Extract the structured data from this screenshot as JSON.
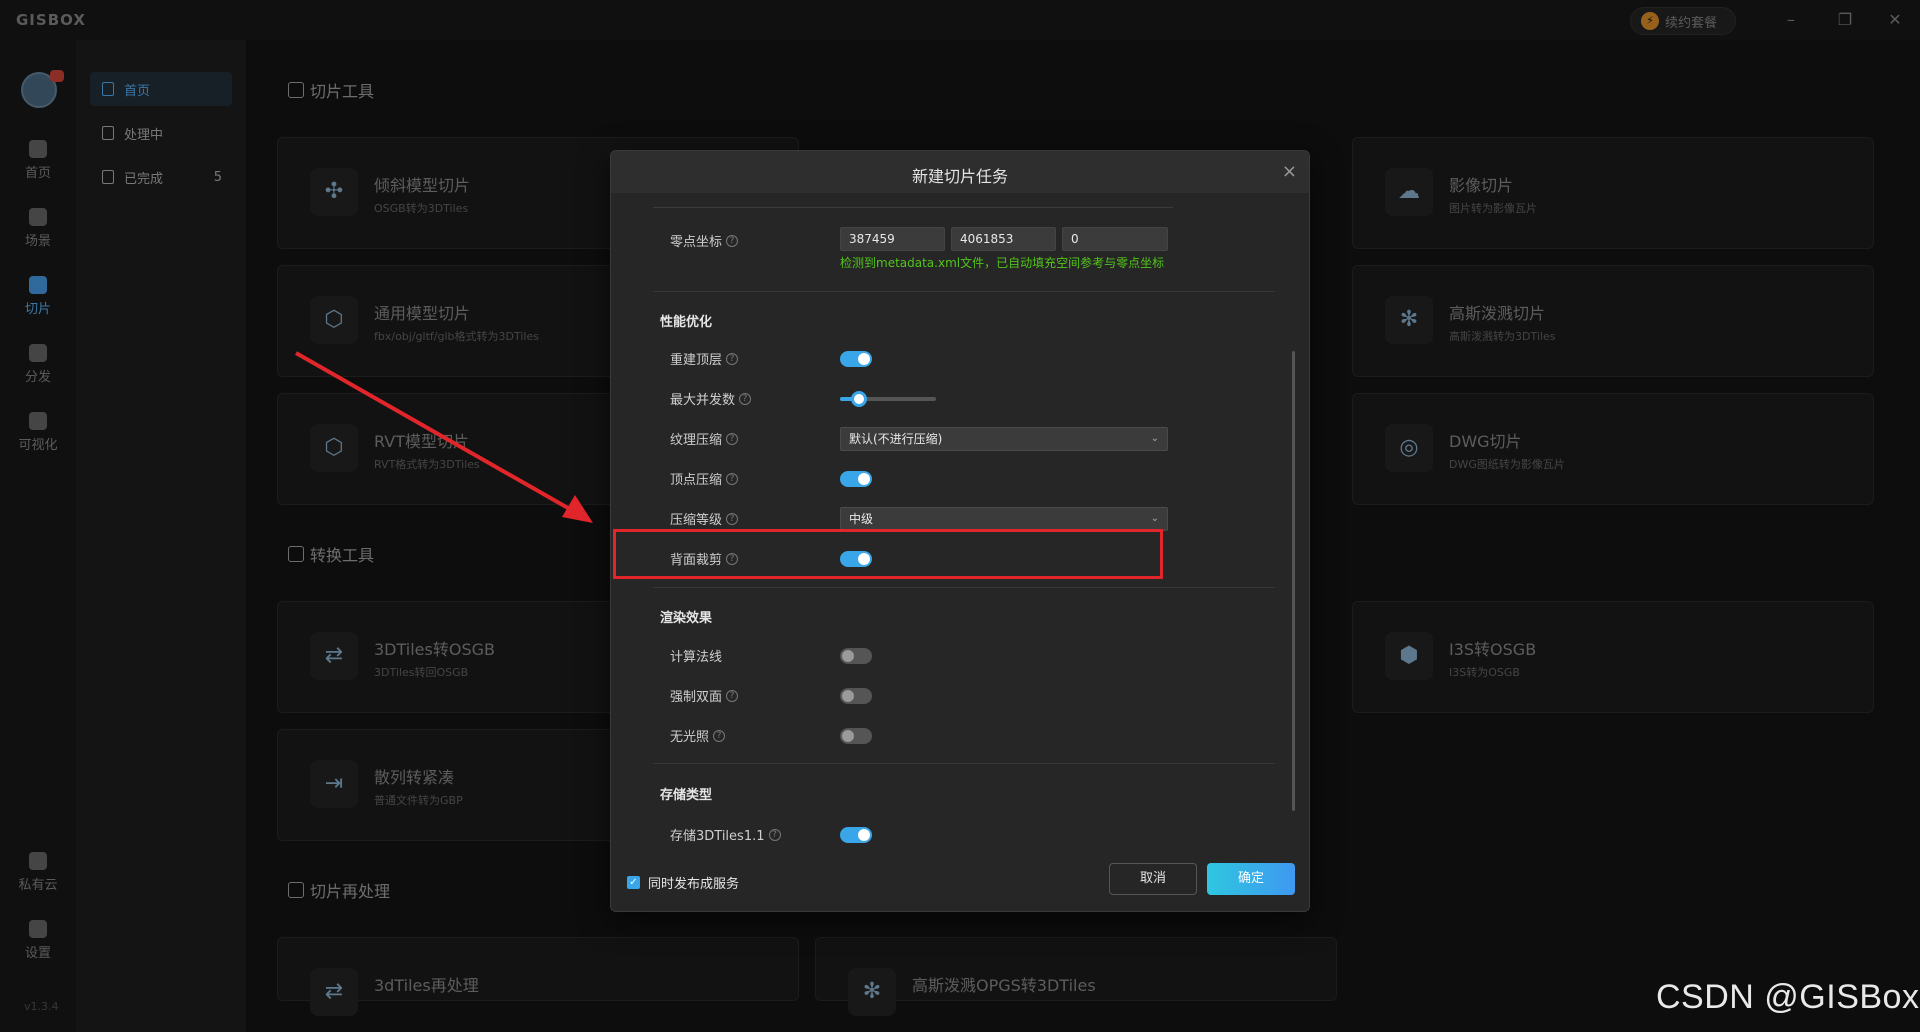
{
  "titlebar": {
    "brand": "GISBOX",
    "package_button": "续约套餐",
    "minimize": "–",
    "restore": "❐",
    "close": "✕"
  },
  "rail": {
    "items": [
      {
        "label": "首页"
      },
      {
        "label": "场景"
      },
      {
        "label": "切片"
      },
      {
        "label": "分发"
      },
      {
        "label": "可视化"
      },
      {
        "label": "私有云"
      },
      {
        "label": "设置"
      }
    ],
    "version": "v1.3.4"
  },
  "subnav": {
    "items": [
      {
        "label": "首页"
      },
      {
        "label": "处理中"
      },
      {
        "label": "已完成",
        "count": "5"
      }
    ]
  },
  "sections": {
    "slice_tools": "切片工具",
    "convert_tools": "转换工具",
    "reprocess": "切片再处理"
  },
  "cards": [
    {
      "title": "倾斜模型切片",
      "sub": "OSGB转为3DTiles"
    },
    {
      "title": "通用模型切片",
      "sub": "fbx/obj/gltf/glb格式转为3DTiles"
    },
    {
      "title": "RVT模型切片",
      "sub": "RVT格式转为3DTiles"
    },
    {
      "title": "影像切片",
      "sub": "图片转为影像瓦片"
    },
    {
      "title": "高斯泼溅切片",
      "sub": "高斯泼溅转为3DTiles"
    },
    {
      "title": "DWG切片",
      "sub": "DWG图纸转为影像瓦片"
    },
    {
      "title": "3DTiles转OSGB",
      "sub": "3DTiles转回OSGB"
    },
    {
      "title": "散列转紧凑",
      "sub": "普通文件转为GBP"
    },
    {
      "title": "I3S转OSGB",
      "sub": "I3S转为OSGB"
    },
    {
      "title": "3dTiles再处理",
      "sub": ""
    },
    {
      "title": "高斯泼溅OPGS转3DTiles",
      "sub": ""
    }
  ],
  "modal": {
    "title": "新建切片任务",
    "origin_label": "零点坐标",
    "origin": [
      "387459",
      "4061853",
      "0"
    ],
    "origin_hint": "检测到metadata.xml文件，已自动填充空间参考与零点坐标",
    "perf_group": "性能优化",
    "rebuild_top": {
      "label": "重建顶层",
      "on": true
    },
    "max_concurrency": {
      "label": "最大并发数",
      "value": 0.2
    },
    "texture_compress": {
      "label": "纹理压缩",
      "value": "默认(不进行压缩)"
    },
    "vertex_compress": {
      "label": "顶点压缩",
      "on": true
    },
    "compress_level": {
      "label": "压缩等级",
      "value": "中级"
    },
    "backface_cull": {
      "label": "背面裁剪",
      "on": true
    },
    "render_group": "渲染效果",
    "calc_normals": {
      "label": "计算法线",
      "on": false
    },
    "force_double": {
      "label": "强制双面",
      "on": false
    },
    "no_lighting": {
      "label": "无光照",
      "on": false
    },
    "storage_group": "存储类型",
    "store_3dtiles11": {
      "label": "存储3DTiles1.1",
      "on": true
    },
    "publish_label": "同时发布成服务",
    "cancel": "取消",
    "ok": "确定"
  },
  "watermark": "CSDN @GISBox",
  "colors": {
    "accent": "#38a6e8",
    "highlight": "#e0262a",
    "hint": "#52c41a"
  }
}
